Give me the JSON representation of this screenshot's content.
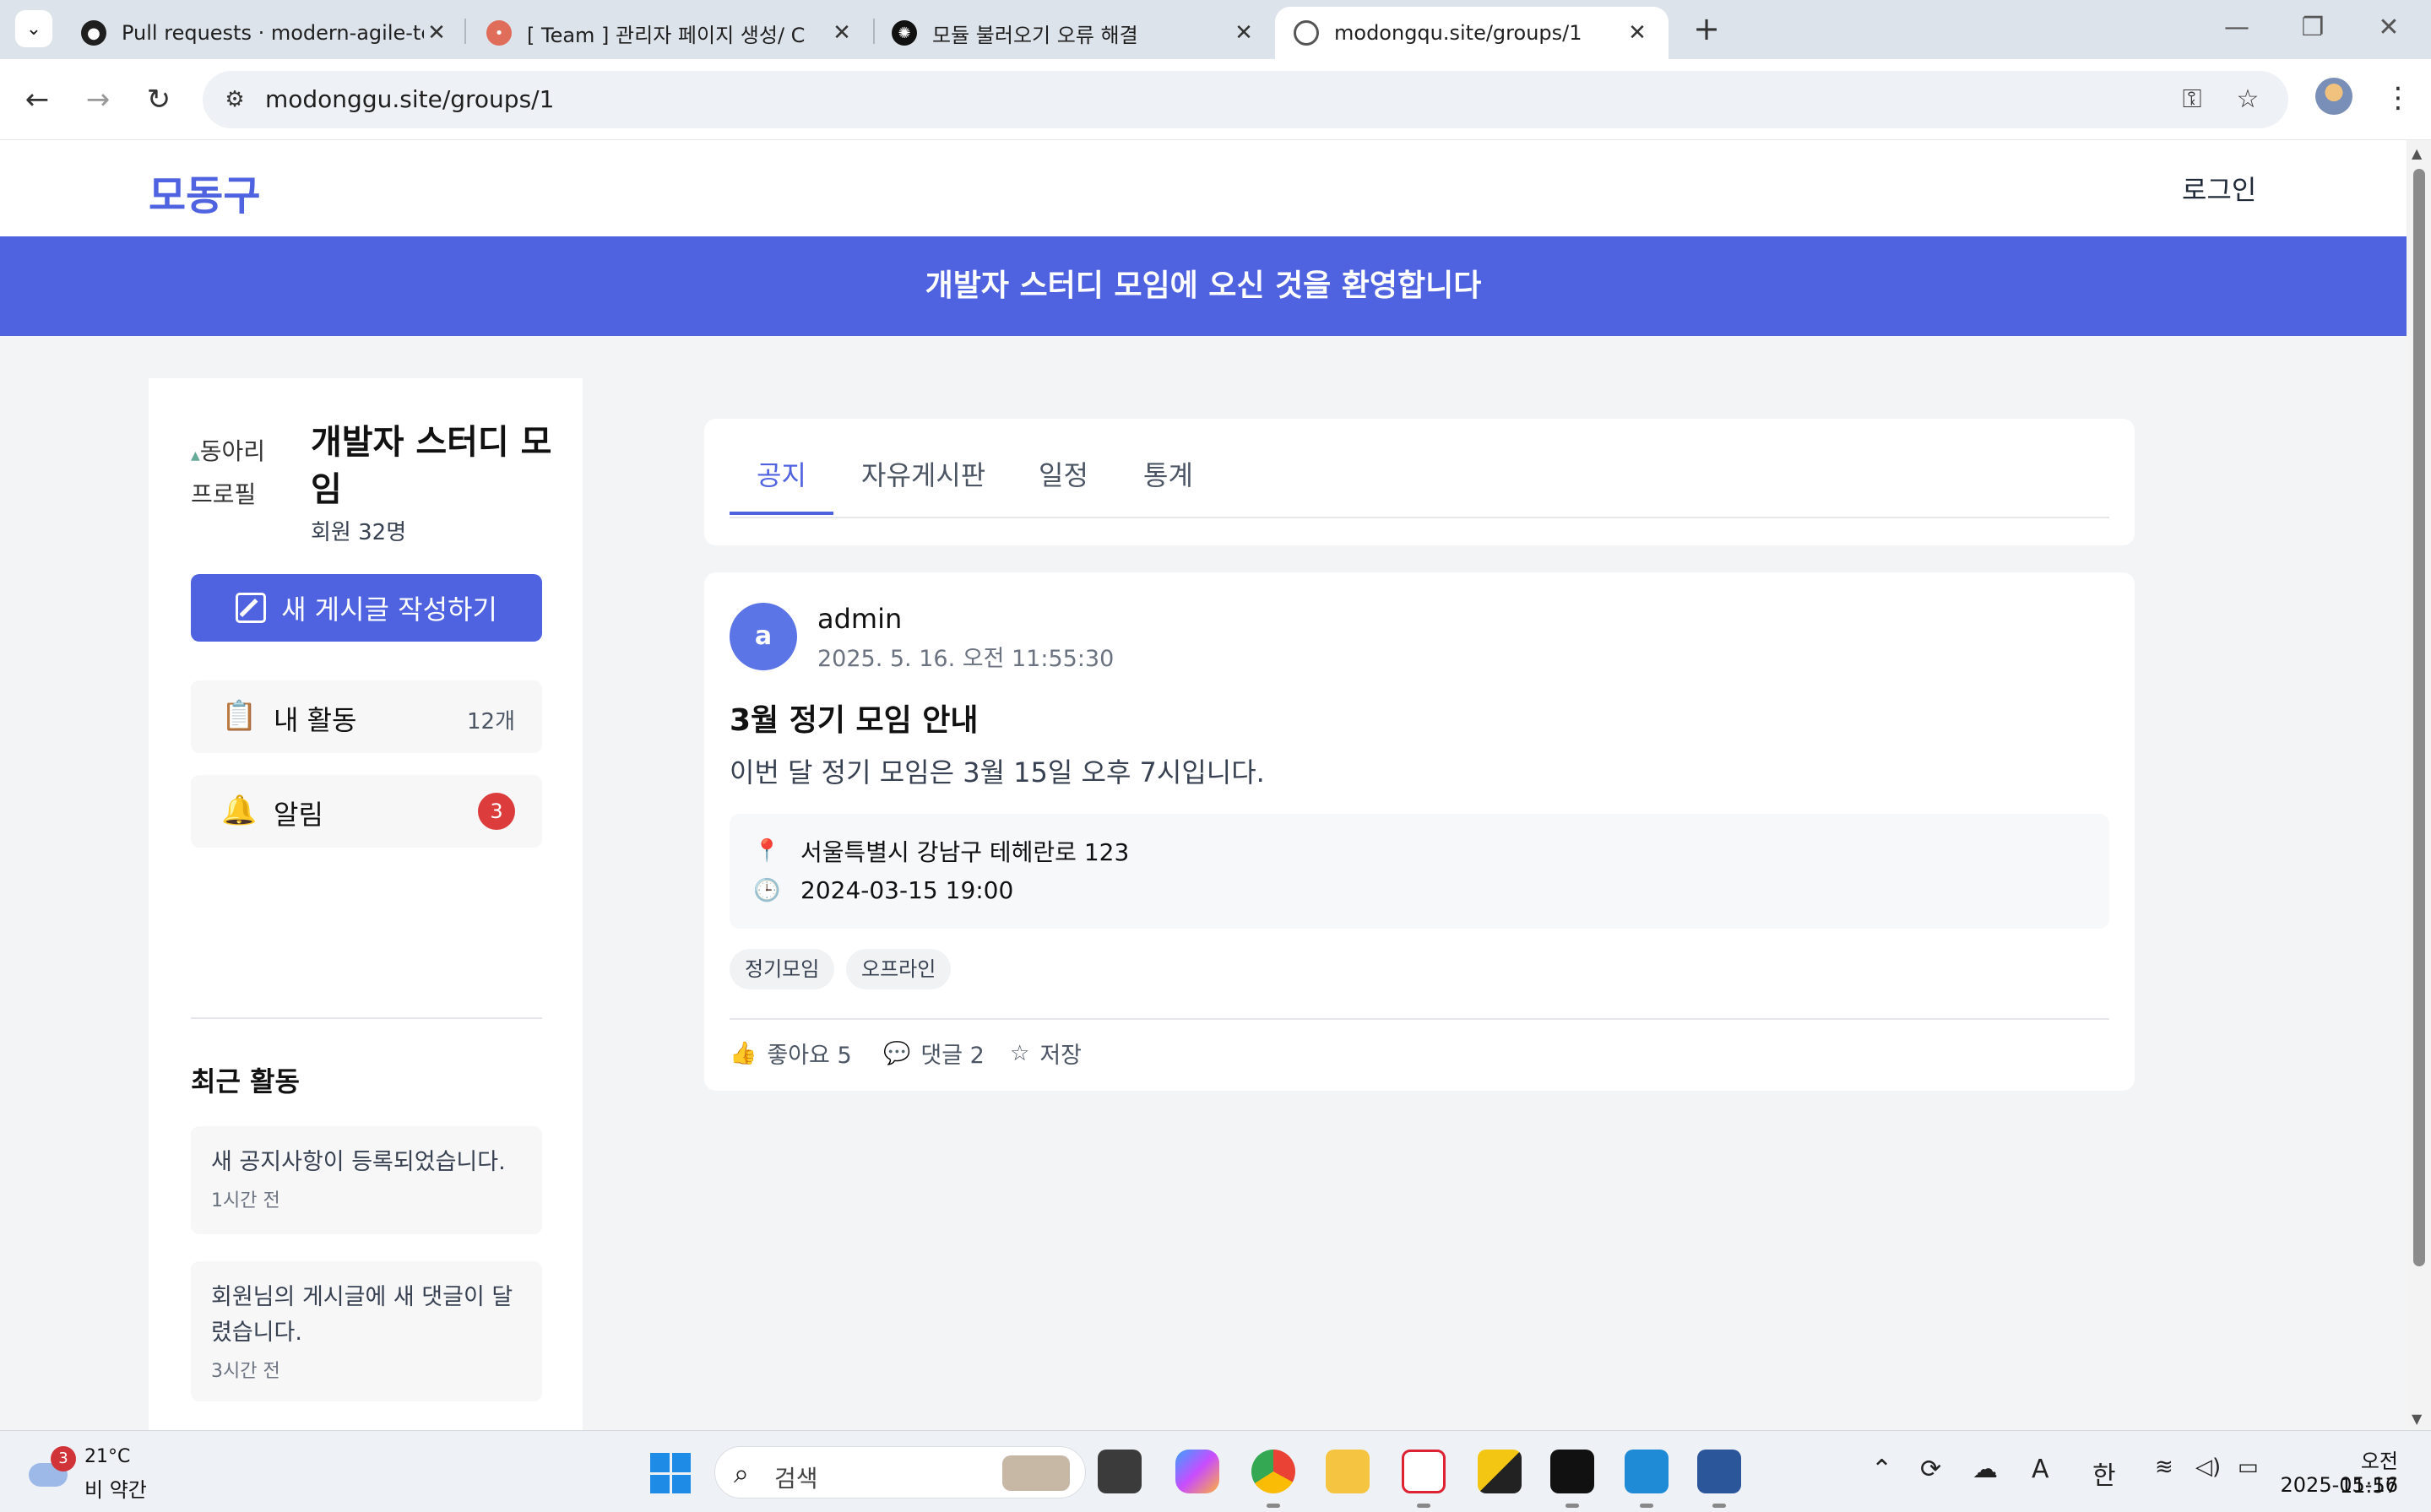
{
  "browser": {
    "tabs": [
      {
        "title": "Pull requests · modern-agile-te",
        "active": false
      },
      {
        "title": "[ Team ] 관리자 페이지 생성/ C",
        "active": false
      },
      {
        "title": "모듈 불러오기 오류 해결",
        "active": false
      },
      {
        "title": "modongqu.site/groups/1",
        "active": true
      }
    ],
    "url": "modonggu.site/groups/1"
  },
  "site": {
    "logo": "모동구",
    "login": "로그인",
    "banner": "개발자 스터디 모임에 오신 것을 환영합니다"
  },
  "sidebar": {
    "club_image_alt": "동아리 프로필",
    "club_name": "개발자 스터디 모임",
    "members": "회원 32명",
    "write_button": "새 게시글 작성하기",
    "my_activity": {
      "label": "내 활동",
      "count": "12개"
    },
    "notifications": {
      "label": "알림",
      "badge": "3"
    },
    "recent_title": "최근 활동",
    "recent": [
      {
        "text": "새 공지사항이 등록되었습니다.",
        "time": "1시간 전"
      },
      {
        "text": "회원님의 게시글에 새 댓글이 달렸습니다.",
        "time": "3시간 전"
      }
    ]
  },
  "tabs": [
    "공지",
    "자유게시판",
    "일정",
    "통계"
  ],
  "active_tab": "공지",
  "post": {
    "avatar_letter": "a",
    "author": "admin",
    "date": "2025. 5. 16. 오전 11:55:30",
    "title": "3월 정기 모임 안내",
    "body": "이번 달 정기 모임은 3월 15일 오후 7시입니다.",
    "location": "서울특별시 강남구 테헤란로 123",
    "datetime": "2024-03-15 19:00",
    "tags": [
      "정기모임",
      "오프라인"
    ],
    "like_label": "좋아요 5",
    "comment_label": "댓글 2",
    "save_label": "저장"
  },
  "taskbar": {
    "weather_badge": "3",
    "temp": "21°C",
    "condition": "비 약간",
    "search_label": "검색",
    "ime": "한",
    "font_indicator": "A",
    "time": "오전 11:57",
    "date": "2025-05-16"
  },
  "colors": {
    "brand": "#4f63e0",
    "badge_red": "#dc3c3c",
    "avatar": "#5b74e6"
  }
}
